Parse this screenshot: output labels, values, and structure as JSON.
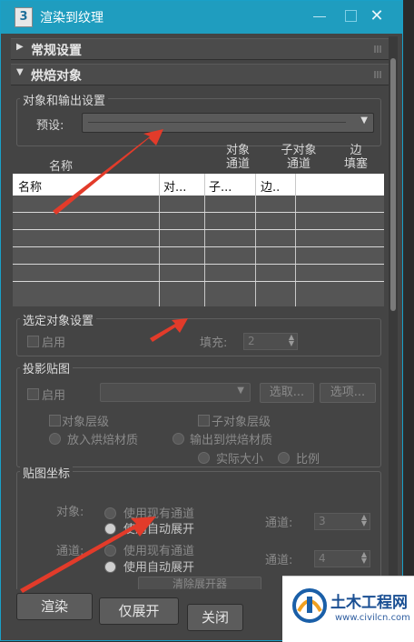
{
  "window": {
    "title": "渲染到纹理",
    "app_icon": "3"
  },
  "rollouts": {
    "common": "常规设置",
    "bake": "烘焙对象"
  },
  "object_output": {
    "group_label": "对象和输出设置",
    "preset_label": "预设:",
    "preset_value": ""
  },
  "table": {
    "top_headers": {
      "name": "名称",
      "object_channel": "对象\n通道",
      "sub_channel": "子对象\n通道",
      "edge_padding": "边\n填塞"
    },
    "columns": [
      "名称",
      "对...",
      "子...",
      "边.."
    ],
    "rows": 5
  },
  "selected": {
    "group_label": "选定对象设置",
    "enable_label": "启用",
    "padding_label": "填充:",
    "padding_value": "2"
  },
  "projection": {
    "group_label": "投影贴图",
    "enable_label": "启用",
    "pick_button": "选取...",
    "options_button": "选项...",
    "object_level": "对象层级",
    "subobject_level": "子对象层级",
    "put_to_bake": "放入烘焙材质",
    "output_to_bake": "输出到烘焙材质",
    "actual_size": "实际大小",
    "proportional": "比例"
  },
  "mapping": {
    "group_label": "贴图坐标",
    "object_label": "对象:",
    "channel_label": "通道:",
    "use_existing": "使用现有通道",
    "use_auto": "使用自动展开",
    "channel_field_label": "通道:",
    "object_channel_value": "3",
    "sub_channel_value": "4",
    "clear_unwrap": "清除展开器"
  },
  "footer": {
    "render": "渲染",
    "unwrap_only": "仅展开",
    "close": "关闭"
  },
  "watermark": {
    "name": "土木工程网",
    "url": "www.civilcn.com"
  },
  "colors": {
    "accent": "#1f9dbf",
    "arrow": "#e23b2a",
    "panel": "#444444"
  }
}
